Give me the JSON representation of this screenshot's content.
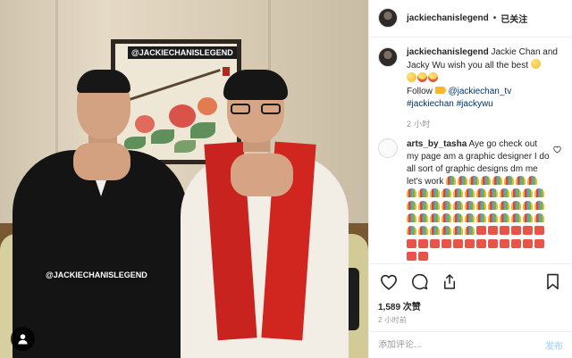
{
  "post": {
    "username": "jackiechanislegend",
    "separator": "•",
    "follow_status": "已关注",
    "photo_watermark_top": "@JACKIECHANISLEGEND",
    "photo_watermark_bottom": "@JACKIECHANISLEGEND"
  },
  "caption": {
    "username": "jackiechanislegend",
    "text": "Jackie Chan and Jacky Wu wish you all the best",
    "follow_word": "Follow",
    "mention": "@jackiechan_tv",
    "hashtags": [
      "#jackiechan",
      "#jackywu"
    ],
    "time": "2 小时"
  },
  "comment": {
    "username": "arts_by_tasha",
    "text": "Aye go check out my page am a graphic designer I do all sort of graphic designs dm me let's work",
    "fan_rows": 5,
    "hundred_rows": 2
  },
  "actions": {
    "like_icon": "heart-outline-icon",
    "comment_icon": "speech-bubble-icon",
    "share_icon": "share-upload-icon",
    "save_icon": "bookmark-icon"
  },
  "likes": "1,589 次赞",
  "post_time": "2 小时前",
  "add_comment": {
    "placeholder": "添加评论...",
    "post_label": "发布"
  }
}
